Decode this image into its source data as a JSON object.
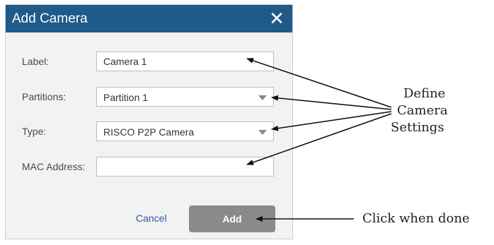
{
  "dialog": {
    "title": "Add Camera",
    "close_glyph": "✕"
  },
  "form": {
    "label": {
      "caption": "Label:",
      "value": "Camera 1"
    },
    "partitions": {
      "caption": "Partitions:",
      "selected": "Partition 1"
    },
    "type": {
      "caption": "Type:",
      "selected": "RISCO P2P Camera"
    },
    "mac": {
      "caption": "MAC Address:",
      "value": ""
    }
  },
  "actions": {
    "cancel_label": "Cancel",
    "add_label": "Add"
  },
  "annotations": {
    "define_settings": [
      "Define",
      "Camera",
      "Settings"
    ],
    "click_when_done": "Click when done"
  },
  "colors": {
    "titlebar": "#1e5a8a",
    "dialog_bg": "#f2f2f2",
    "add_button": "#8a8a8a",
    "cancel_link": "#2a5b98"
  }
}
